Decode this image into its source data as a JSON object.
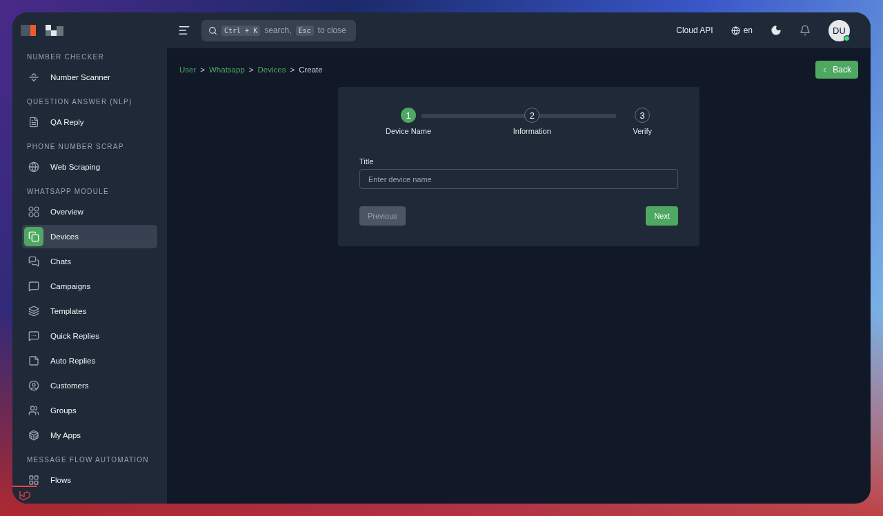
{
  "header": {
    "search": {
      "keys": [
        "Ctrl + K",
        "Esc"
      ],
      "texts": [
        "search,",
        "to close"
      ]
    },
    "api_label": "Cloud API",
    "language": "en",
    "avatar": {
      "initials": "DU",
      "online": true
    }
  },
  "sidebar": {
    "sections": [
      {
        "heading": "NUMBER CHECKER",
        "items": [
          {
            "label": "Number Scanner",
            "selected": false
          }
        ]
      },
      {
        "heading": "QUESTION ANSWER (NLP)",
        "items": [
          {
            "label": "QA Reply",
            "selected": false
          }
        ]
      },
      {
        "heading": "PHONE NUMBER SCRAP",
        "items": [
          {
            "label": "Web Scraping",
            "selected": false
          }
        ]
      },
      {
        "heading": "WHATSAPP MODULE",
        "items": [
          {
            "label": "Overview",
            "selected": false
          },
          {
            "label": "Devices",
            "selected": true
          },
          {
            "label": "Chats",
            "selected": false
          },
          {
            "label": "Campaigns",
            "selected": false
          },
          {
            "label": "Templates",
            "selected": false
          },
          {
            "label": "Quick Replies",
            "selected": false
          },
          {
            "label": "Auto Replies",
            "selected": false
          },
          {
            "label": "Customers",
            "selected": false
          },
          {
            "label": "Groups",
            "selected": false
          },
          {
            "label": "My Apps",
            "selected": false
          }
        ]
      },
      {
        "heading": "MESSAGE FLOW AUTOMATION",
        "items": [
          {
            "label": "Flows",
            "selected": false
          }
        ]
      }
    ]
  },
  "breadcrumb": [
    {
      "label": "User",
      "link": true
    },
    {
      "separator": ">",
      "label": "Whatsapp",
      "link": true
    },
    {
      "separator": ">",
      "label": "Devices",
      "link": true
    },
    {
      "separator": ">",
      "label": "Create",
      "link": false
    }
  ],
  "back_button": "Back",
  "stepper": [
    {
      "number": "1",
      "label": "Device Name",
      "active": true
    },
    {
      "number": "2",
      "label": "Information",
      "active": false
    },
    {
      "number": "3",
      "label": "Verify",
      "active": false
    }
  ],
  "form": {
    "label": "Title",
    "placeholder": "Enter device name"
  },
  "buttons": {
    "previous": {
      "label": "Previous",
      "disabled": true
    },
    "next": {
      "label": "Next",
      "disabled": false
    }
  }
}
